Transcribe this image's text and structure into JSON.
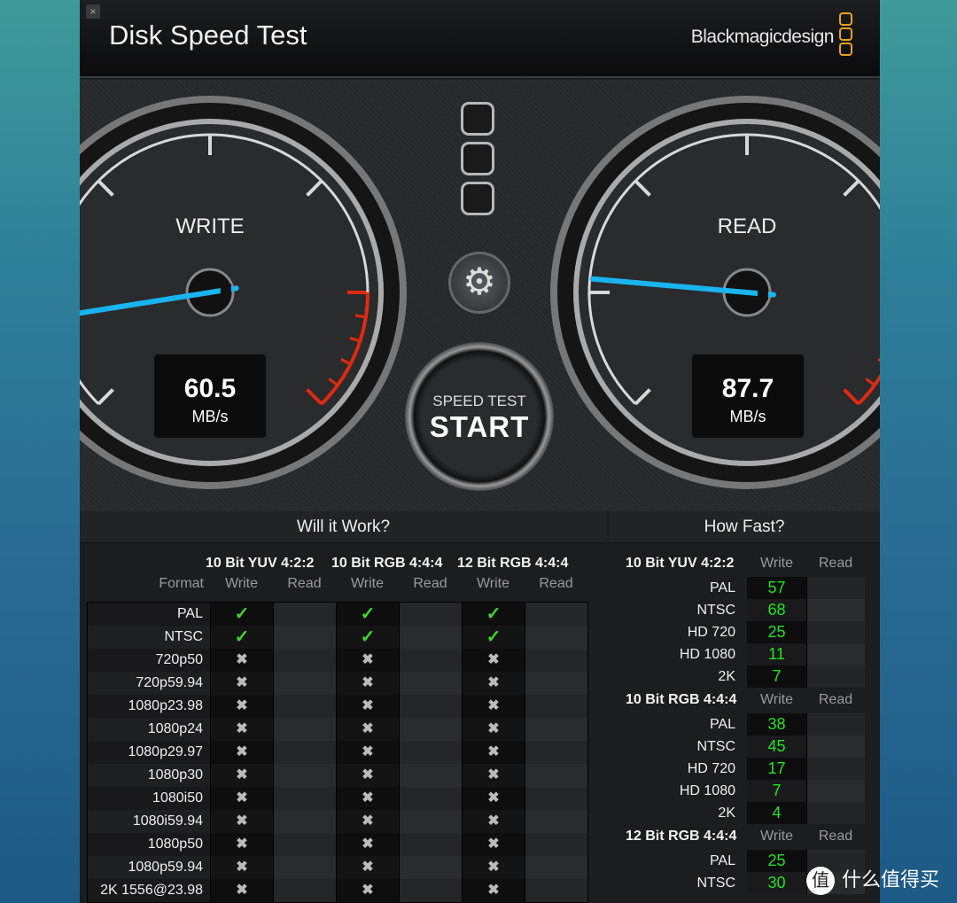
{
  "window": {
    "title": "Disk Speed Test",
    "close_icon": "close-icon",
    "brand": "Blackmagicdesign"
  },
  "gauges": {
    "write": {
      "label": "WRITE",
      "value": "60.5",
      "unit": "MB/s"
    },
    "read": {
      "label": "READ",
      "value": "87.7",
      "unit": "MB/s"
    },
    "needle_color": "#19b4f0",
    "redzone_color": "#e02a10"
  },
  "settings_icon": "gear-icon",
  "start_button": {
    "line1": "SPEED TEST",
    "line2": "START"
  },
  "will_it_work": {
    "title": "Will it Work?",
    "groups": [
      "10 Bit YUV 4:2:2",
      "10 Bit RGB 4:4:4",
      "12 Bit RGB 4:4:4"
    ],
    "format_header": "Format",
    "write_header": "Write",
    "read_header": "Read",
    "rows": [
      {
        "format": "PAL",
        "write": [
          "ok",
          "ok",
          "ok"
        ]
      },
      {
        "format": "NTSC",
        "write": [
          "ok",
          "ok",
          "ok"
        ]
      },
      {
        "format": "720p50",
        "write": [
          "no",
          "no",
          "no"
        ]
      },
      {
        "format": "720p59.94",
        "write": [
          "no",
          "no",
          "no"
        ]
      },
      {
        "format": "1080p23.98",
        "write": [
          "no",
          "no",
          "no"
        ]
      },
      {
        "format": "1080p24",
        "write": [
          "no",
          "no",
          "no"
        ]
      },
      {
        "format": "1080p29.97",
        "write": [
          "no",
          "no",
          "no"
        ]
      },
      {
        "format": "1080p30",
        "write": [
          "no",
          "no",
          "no"
        ]
      },
      {
        "format": "1080i50",
        "write": [
          "no",
          "no",
          "no"
        ]
      },
      {
        "format": "1080i59.94",
        "write": [
          "no",
          "no",
          "no"
        ]
      },
      {
        "format": "1080p50",
        "write": [
          "no",
          "no",
          "no"
        ]
      },
      {
        "format": "1080p59.94",
        "write": [
          "no",
          "no",
          "no"
        ]
      },
      {
        "format": "2K 1556@23.98",
        "write": [
          "no",
          "no",
          "no"
        ]
      }
    ]
  },
  "how_fast": {
    "title": "How Fast?",
    "write_header": "Write",
    "read_header": "Read",
    "groups": [
      {
        "name": "10 Bit YUV 4:2:2",
        "rows": [
          {
            "format": "PAL",
            "write": "57"
          },
          {
            "format": "NTSC",
            "write": "68"
          },
          {
            "format": "HD 720",
            "write": "25"
          },
          {
            "format": "HD 1080",
            "write": "11"
          },
          {
            "format": "2K",
            "write": "7"
          }
        ]
      },
      {
        "name": "10 Bit RGB 4:4:4",
        "rows": [
          {
            "format": "PAL",
            "write": "38"
          },
          {
            "format": "NTSC",
            "write": "45"
          },
          {
            "format": "HD 720",
            "write": "17"
          },
          {
            "format": "HD 1080",
            "write": "7"
          },
          {
            "format": "2K",
            "write": "4"
          }
        ]
      },
      {
        "name": "12 Bit RGB 4:4:4",
        "rows": [
          {
            "format": "PAL",
            "write": "25"
          },
          {
            "format": "NTSC",
            "write": "30"
          }
        ]
      }
    ]
  },
  "watermark": {
    "badge": "值",
    "text": "什么值得买"
  }
}
